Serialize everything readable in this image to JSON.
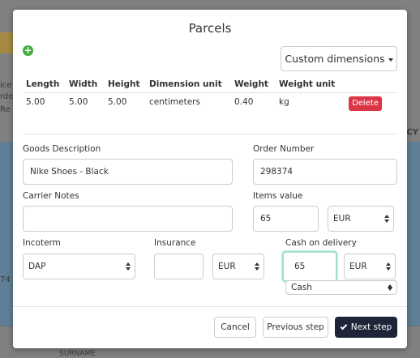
{
  "background": {
    "frag_top": "ice",
    "frag_mid1": "rde",
    "frag_mid2": "Re",
    "frag_right": "CY",
    "frag_left": "74",
    "frag_bottom": "SURNAME"
  },
  "modal": {
    "title": "Parcels",
    "add_icon": "plus-circle-icon",
    "custom_dimensions_label": "Custom dimensions",
    "table": {
      "headers": [
        "Length",
        "Width",
        "Height",
        "Dimension unit",
        "Weight",
        "Weight unit"
      ],
      "rows": [
        [
          "5.00",
          "5.00",
          "5.00",
          "centimeters",
          "0.40",
          "kg"
        ]
      ],
      "delete_label": "Delete"
    },
    "form": {
      "goods_description": {
        "label": "Goods Description",
        "value": "Nike Shoes - Black"
      },
      "order_number": {
        "label": "Order Number",
        "value": "298374"
      },
      "carrier_notes": {
        "label": "Carrier Notes",
        "value": ""
      },
      "items_value": {
        "label": "Items value",
        "value": "65",
        "currency": "EUR"
      },
      "incoterm": {
        "label": "Incoterm",
        "value": "DAP"
      },
      "insurance": {
        "label": "Insurance",
        "value": "",
        "currency": "EUR"
      },
      "cash_on_delivery": {
        "label": "Cash on delivery",
        "value": "65",
        "currency": "EUR",
        "method": "Cash"
      }
    },
    "footer": {
      "cancel_label": "Cancel",
      "previous_label": "Previous step",
      "next_label": "Next step"
    }
  },
  "colors": {
    "delete": "#dc3545",
    "next": "#1e2538",
    "add": "#3cab3b",
    "focus": "#9fe0cf"
  }
}
